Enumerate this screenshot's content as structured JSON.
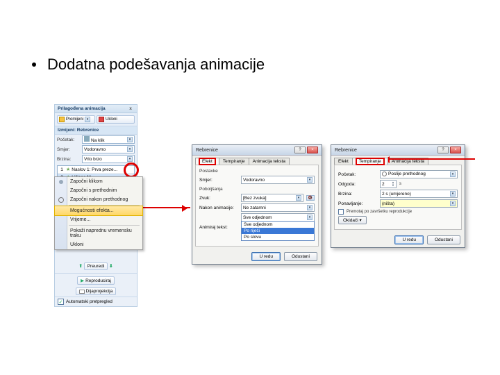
{
  "heading": "Dodatna podešavanja animacije",
  "pane": {
    "title": "Prilagođena animacija",
    "close": "x",
    "change_btn": "Promijeni",
    "remove_btn": "Ukloni",
    "section": "Izmijeni: Rebrenice",
    "fields": {
      "start_lbl": "Početak:",
      "start_val": "Na klik",
      "dir_lbl": "Smjer:",
      "dir_val": "Vodoravno",
      "speed_lbl": "Brzina:",
      "speed_val": "Vrlo brzo"
    },
    "list": [
      {
        "n": "1",
        "txt": "Naslov 1: Prva preze..."
      },
      {
        "n": "2",
        "txt": "Ljiljana M."
      }
    ],
    "reorder": "Preuredi",
    "play": "Reproduciraj",
    "slideshow": "Dijaprojekcija",
    "autopreview": "Automatski pretpregled"
  },
  "ctx": {
    "items": [
      "Započni klikom",
      "Započni s prethodnim",
      "Započni nakon prethodnog",
      "Mogućnosti efekta...",
      "Vrijeme...",
      "Pokaži naprednu vremensku traku",
      "Ukloni"
    ]
  },
  "dlg1": {
    "title": "Rebrenice",
    "tabs": [
      "Efekt",
      "Tempiranje",
      "Animacija teksta"
    ],
    "group": "Postavke",
    "rows": {
      "dir_lbl": "Smjer:",
      "dir_val": "Vodoravno",
      "enh_lbl": "Poboljšanja",
      "sound_lbl": "Zvuk:",
      "sound_val": "[Bez zvuka]",
      "after_lbl": "Nakon animacije:",
      "after_val": "Ne zatamni",
      "text_lbl": "Animiraj tekst:",
      "text_val": "Sve odjednom"
    },
    "open_options": [
      "Sve odjednom",
      "Po riječi",
      "Po slovu"
    ],
    "ok": "U redu",
    "cancel": "Odustani"
  },
  "dlg2": {
    "title": "Rebrenice",
    "tabs": [
      "Efekt",
      "Tempiranje",
      "Animacija teksta"
    ],
    "rows": {
      "start_lbl": "Početak:",
      "start_val": "Poslije prethodnog",
      "delay_lbl": "Odgoda:",
      "delay_val": "2",
      "delay_unit": "s",
      "speed_lbl": "Brzina:",
      "speed_val": "2 s (umjereno)",
      "repeat_lbl": "Ponavljanje:",
      "repeat_val": "(ništa)",
      "rewind": "Premotaj po završetku reprodukcije"
    },
    "triggers_btn": "Okidači",
    "ok": "U redu",
    "cancel": "Odustani"
  }
}
